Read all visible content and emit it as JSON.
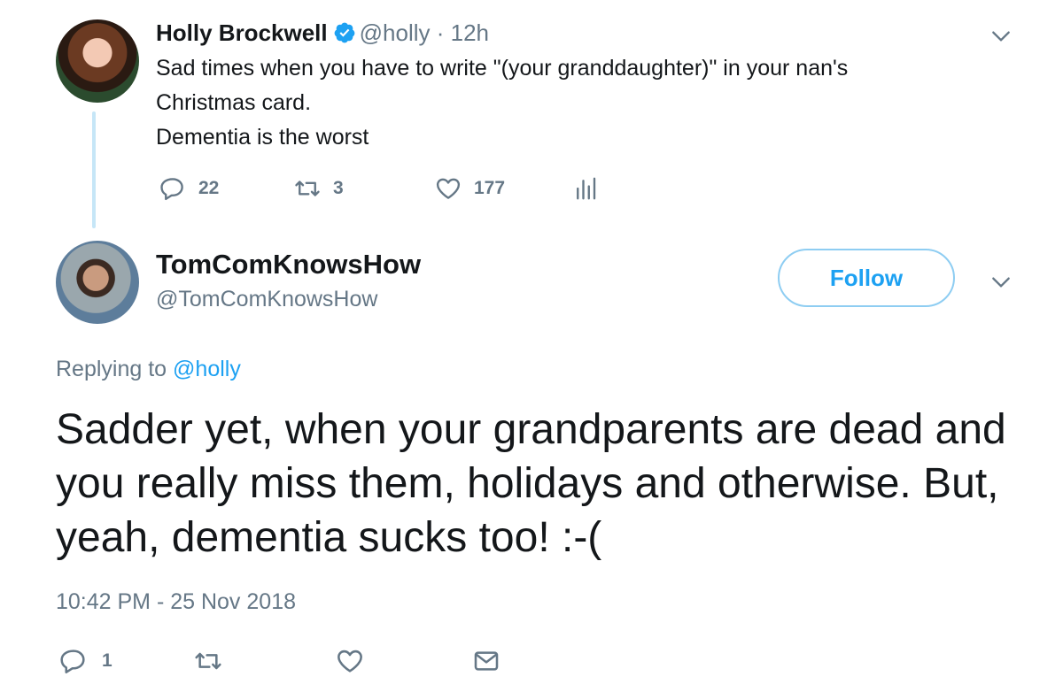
{
  "original_tweet": {
    "author_name": "Holly Brockwell",
    "handle": "@holly",
    "separator": "·",
    "time": "12h",
    "text_lines": [
      "Sad times when you have to write \"(your granddaughter)\" in your nan's",
      "Christmas card.",
      "Dementia is the worst"
    ],
    "replies": "22",
    "retweets": "3",
    "likes": "177",
    "verified_icon": "verified-badge-icon",
    "menu_icon": "chevron-down-icon"
  },
  "reply_tweet": {
    "author_name": "TomComKnowsHow",
    "handle": "@TomComKnowsHow",
    "follow_label": "Follow",
    "replying_prefix": "Replying to",
    "replying_handle": "@holly",
    "text": "Sadder yet, when your grandparents are dead and you really miss them, holidays and otherwise. But, yeah, dementia sucks too! :-(",
    "timestamp": "10:42 PM - 25 Nov 2018",
    "replies": "1",
    "menu_icon": "chevron-down-icon"
  },
  "colors": {
    "accent": "#1da1f2",
    "muted": "#657786",
    "text": "#14171a",
    "thread_line": "#c6e6f7"
  }
}
